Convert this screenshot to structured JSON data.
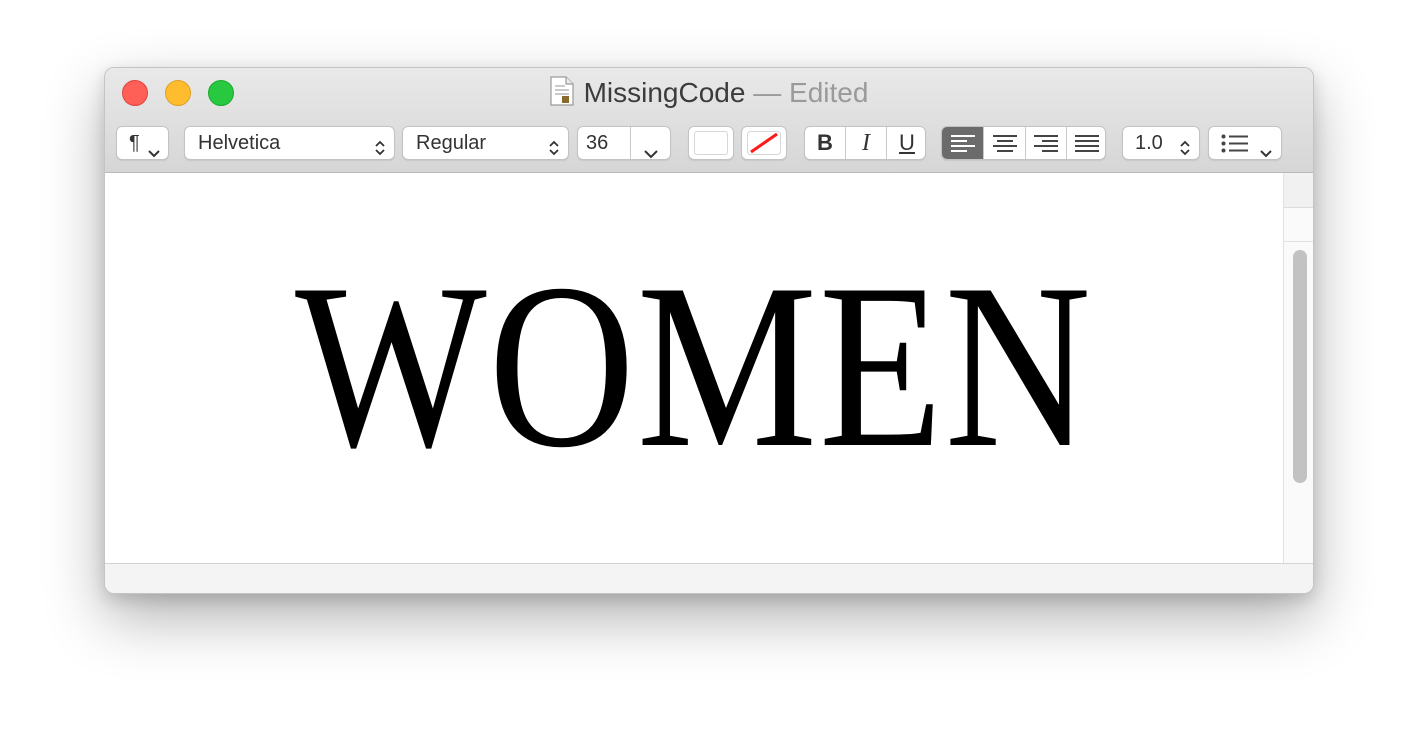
{
  "window": {
    "title": "MissingCode",
    "title_suffix": " — Edited"
  },
  "icons": {
    "close": "window-close",
    "minimize": "window-minimize",
    "zoom": "window-zoom",
    "doc": "document-icon",
    "paragraph": "pilcrow-icon",
    "list": "bulleted-list-icon"
  },
  "toolbar": {
    "paragraph_style": "¶",
    "font_family": "Helvetica",
    "font_style": "Regular",
    "font_size": "36",
    "bold": "B",
    "italic": "I",
    "underline": "U",
    "line_spacing": "1.0",
    "alignment_selected": "left"
  },
  "document": {
    "text": "WOMEN"
  },
  "colors": {
    "close": "#fe5f57",
    "minimize": "#febc2e",
    "zoom": "#28c840",
    "align_selected": "#6b6b6b"
  }
}
